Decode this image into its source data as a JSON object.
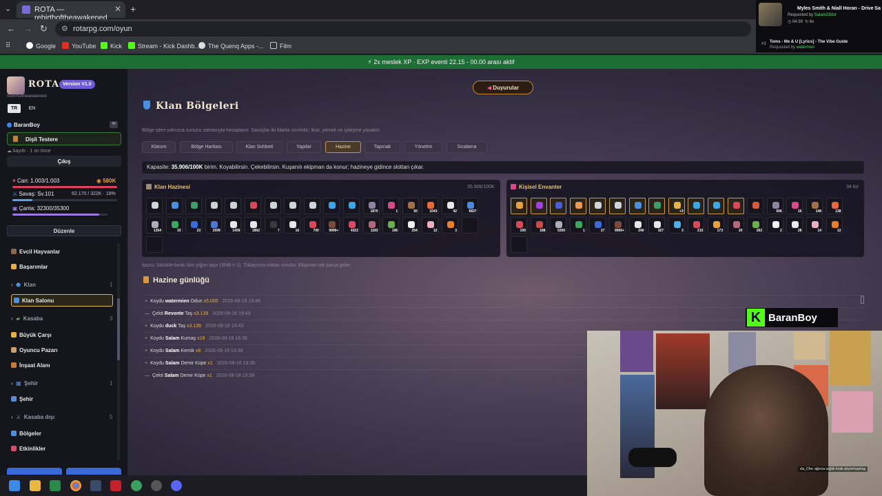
{
  "browser": {
    "tab_title": "ROTA — rebirthoftheawakened",
    "url": "rotarpg.com/oyun",
    "bookmarks": [
      "Google",
      "YouTube",
      "Kick",
      "Stream - Kick Dashb...",
      "The Quenq Apps -...",
      "Film"
    ]
  },
  "music": {
    "title": "Myles Smith & Niall Horan - Drive Sa",
    "requested_label": "Requested by",
    "requested_by": "Salam23dur",
    "time": "04:39",
    "plays": "6x",
    "queue_num": "#3",
    "next_title": "Toms - Me & U [Lyrics] - The Vibe Guide",
    "next_requested_by": "watermen"
  },
  "banner": "2x meslek XP · EXP eventi 22.15 - 00.00 arası aktif",
  "sidebar": {
    "brand": "ROTA",
    "version": "Version V1.0",
    "brand_sub": "rebirthoftheawakened",
    "lang_tr": "TR",
    "lang_en": "EN",
    "player": "BaranBoy",
    "job": "Dişli Testere",
    "last_seen": "kayıtlı · 1 sn önce",
    "logout": "Çıkış",
    "stats": {
      "hp_label": "Can: 1.003/1.003",
      "gold": "580K",
      "war_label": "Savaş: Sv.101",
      "war_value": "62.170 / 322K · 19%",
      "bag_label": "Çanta: 32300/35300",
      "hp_fill": 1.0,
      "war_fill": 0.19,
      "bag_fill": 0.915
    },
    "edit": "Düzenle",
    "nav": {
      "pets": "Evcil Hayvanlar",
      "achievements": "Başarımlar",
      "clan_header": "Klan",
      "clan_count": "1",
      "clan_hall": "Klan Salonu",
      "town_header": "Kasaba",
      "town_count": "3",
      "big_market": "Büyük Çarşı",
      "player_market": "Oyuncu Pazarı",
      "construction": "İnşaat Alanı",
      "city_header": "Şehir",
      "city_count": "1",
      "city": "Şehir",
      "outside_header": "Kasaba dışı",
      "outside_count": "5",
      "regions": "Bölgeler",
      "events": "Etkinlikler"
    }
  },
  "main": {
    "announce": "Duyurular",
    "title": "Klan Bölgeleri",
    "subtitle": "Bölge işleri yalnızca sunucu zamanıyla hesaplanır. Savaşlar iki klanla sınırlıdır; iksir, yemek ve iyileşme yasaktır.",
    "tabs": [
      "Klanım",
      "Bölge Haritası",
      "Klan Sohbeti",
      "Yapılar",
      "Hazine",
      "Tapınak",
      "Yönetim",
      "Sıralama"
    ],
    "capacity_prefix": "Kapasite:",
    "capacity_value": "35.906/100K",
    "capacity_suffix": "birim. Koyabilirsin. Çekebilirsin. Kuşanılı ekipman da konur; hazineye gidince slottan çıkar.",
    "clan_treasury_title": "Klan Hazinesi",
    "clan_treasury_meta": "35.906/100K",
    "inventory_title": "Kişisel Envanter",
    "inventory_meta": "34 tür",
    "treasury_slots": [
      {
        "icon": "chain",
        "color": "#cfd3da",
        "count": ""
      },
      {
        "icon": "shield",
        "color": "#4b8fe0",
        "count": ""
      },
      {
        "icon": "helm",
        "color": "#3e9e6a",
        "count": ""
      },
      {
        "icon": "swords",
        "color": "#cfcfd6",
        "count": ""
      },
      {
        "icon": "swords",
        "color": "#cfcfd6",
        "count": ""
      },
      {
        "icon": "armor",
        "color": "#d8485a",
        "count": ""
      },
      {
        "icon": "chain",
        "color": "#cfd3da",
        "count": ""
      },
      {
        "icon": "chain",
        "color": "#cfd3da",
        "count": ""
      },
      {
        "icon": "chain",
        "color": "#cfd3da",
        "count": ""
      },
      {
        "icon": "gem",
        "color": "#3aa7e8",
        "count": ""
      },
      {
        "icon": "gem",
        "color": "#3aa7e8",
        "count": ""
      },
      {
        "icon": "medal",
        "color": "#8d84a0",
        "count": "1870"
      },
      {
        "icon": "hook",
        "color": "#d84a8a",
        "count": "1"
      },
      {
        "icon": "ore",
        "color": "#a0704a",
        "count": "50"
      },
      {
        "icon": "orb",
        "color": "#e86a3a",
        "count": "1043"
      },
      {
        "icon": "cloth",
        "color": "#e8e8ec",
        "count": "42"
      },
      {
        "icon": "fish",
        "color": "#4a8ad8",
        "count": "6837"
      },
      {
        "icon": "chain2",
        "color": "#aab0ba",
        "count": "1354"
      },
      {
        "icon": "herb",
        "color": "#3aa860",
        "count": "33"
      },
      {
        "icon": "bluecrys",
        "color": "#3a6ad8",
        "count": "23"
      },
      {
        "icon": "feather",
        "color": "#4a7ad8",
        "count": "2599"
      },
      {
        "icon": "pearl",
        "color": "#e6e6ea",
        "count": "1459"
      },
      {
        "icon": "bone",
        "color": "#e6e6ea",
        "count": "1892"
      },
      {
        "icon": "box",
        "color": "#3a3a3e",
        "count": "7"
      },
      {
        "icon": "paper",
        "color": "#e6e6ea",
        "count": "16"
      },
      {
        "icon": "scissors",
        "color": "#d84a5a",
        "count": "700"
      },
      {
        "icon": "bottle",
        "color": "#7a4a3a",
        "count": "9999+"
      },
      {
        "icon": "brick",
        "color": "#d84a6a",
        "count": "4322"
      },
      {
        "icon": "hog",
        "color": "#b06a7a",
        "count": "1183"
      },
      {
        "icon": "plant",
        "color": "#6ab04a",
        "count": "196"
      },
      {
        "icon": "square",
        "color": "#f0f0f2",
        "count": "254"
      },
      {
        "icon": "potion",
        "color": "#e8b0c0",
        "count": "12"
      },
      {
        "icon": "flame",
        "color": "#e8802a",
        "count": "3"
      },
      {
        "icon": "empty",
        "color": "",
        "count": ""
      },
      {
        "icon": "empty",
        "color": "",
        "count": ""
      }
    ],
    "inventory_slots": [
      {
        "icon": "boat",
        "color": "#e8a040",
        "count": "",
        "gold": true
      },
      {
        "icon": "purple",
        "color": "#a040e0",
        "count": "",
        "gold": true
      },
      {
        "icon": "staff",
        "color": "#4a5ad8",
        "count": "",
        "gold": true
      },
      {
        "icon": "tent",
        "color": "#e89a50",
        "count": "",
        "gold": true
      },
      {
        "icon": "chain",
        "color": "#cfd3da",
        "count": "",
        "gold": true
      },
      {
        "icon": "chain",
        "color": "#cfd3da",
        "count": "",
        "gold": true
      },
      {
        "icon": "shield",
        "color": "#4b8fe0",
        "count": "",
        "gold": true
      },
      {
        "icon": "helm",
        "color": "#3e9e6a",
        "count": "",
        "gold": true
      },
      {
        "icon": "sword",
        "color": "#e6b04a",
        "count": "+3",
        "gold": true
      },
      {
        "icon": "gem",
        "color": "#3aa7e8",
        "count": "",
        "gold": true
      },
      {
        "icon": "gem",
        "color": "#3aa7e8",
        "count": "",
        "gold": true
      },
      {
        "icon": "armor",
        "color": "#d8485a",
        "count": "",
        "gold": true
      },
      {
        "icon": "dagger",
        "color": "#d85a3a",
        "count": "",
        "gold": false
      },
      {
        "icon": "medal",
        "color": "#8d84a0",
        "count": "506",
        "gold": false
      },
      {
        "icon": "hook",
        "color": "#d84a8a",
        "count": "16",
        "gold": false
      },
      {
        "icon": "ore",
        "color": "#a0704a",
        "count": "148",
        "gold": false
      },
      {
        "icon": "orb",
        "color": "#e86a3a",
        "count": "138",
        "gold": false
      },
      {
        "icon": "redball",
        "color": "#d84a5a",
        "count": "199",
        "gold": false
      },
      {
        "icon": "meat",
        "color": "#c84a4a",
        "count": "188",
        "gold": false
      },
      {
        "icon": "chain2",
        "color": "#aab0ba",
        "count": "5350",
        "gold": false
      },
      {
        "icon": "herb",
        "color": "#3aa860",
        "count": "1",
        "gold": false
      },
      {
        "icon": "bluecrys",
        "color": "#3a6ad8",
        "count": "27",
        "gold": false
      },
      {
        "icon": "bottle",
        "color": "#7a4a3a",
        "count": "9999+",
        "gold": false
      },
      {
        "icon": "pearl",
        "color": "#e6e6ea",
        "count": "240",
        "gold": false
      },
      {
        "icon": "bone",
        "color": "#e6e6ea",
        "count": "327",
        "gold": false
      },
      {
        "icon": "diamond",
        "color": "#4ab0e8",
        "count": "3",
        "gold": false
      },
      {
        "icon": "feather",
        "color": "#d84a5a",
        "count": "215",
        "gold": false
      },
      {
        "icon": "bag",
        "color": "#e8a030",
        "count": "173",
        "gold": false
      },
      {
        "icon": "hog",
        "color": "#b06a7a",
        "count": "20",
        "gold": false
      },
      {
        "icon": "plant",
        "color": "#6ab04a",
        "count": "262",
        "gold": false
      },
      {
        "icon": "square",
        "color": "#f0f0f2",
        "count": "2",
        "gold": false
      },
      {
        "icon": "cloth",
        "color": "#e8e8ec",
        "count": "28",
        "gold": false
      },
      {
        "icon": "potion",
        "color": "#e8b0c0",
        "count": "14",
        "gold": false
      },
      {
        "icon": "flame",
        "color": "#e8802a",
        "count": "12",
        "gold": false
      },
      {
        "icon": "empty",
        "color": "",
        "count": "",
        "gold": false
      }
    ],
    "tip": "İpucu: Sürükle-bırak tüm yığını taşır (Shift = 1). Tıklayınca miktar sorulur. Ekipman tek parça gider.",
    "log_title": "Hazine günlüğü",
    "log": [
      {
        "sign": "+",
        "action": "Koydu",
        "user": "watermien",
        "item": "Odun",
        "qty": "x5.000",
        "date": "2026-08-16 19:49"
      },
      {
        "sign": "—",
        "action": "Çekti",
        "user": "Revonte",
        "item": "Taş",
        "qty": "x3.139",
        "date": "2026-08-16 19:43"
      },
      {
        "sign": "+",
        "action": "Koydu",
        "user": "duck",
        "item": "Taş",
        "qty": "x3.139",
        "date": "2026-08-16 19:43"
      },
      {
        "sign": "+",
        "action": "Koydu",
        "user": "Salam",
        "item": "Kumaş",
        "qty": "x16",
        "date": "2026-08-16 19:38"
      },
      {
        "sign": "+",
        "action": "Koydu",
        "user": "Salam",
        "item": "Kemik",
        "qty": "x8",
        "date": "2026-08-16 19:38"
      },
      {
        "sign": "+",
        "action": "Koydu",
        "user": "Salam",
        "item": "Demir Küpe",
        "qty": "x1",
        "date": "2026-08-16 19:38"
      },
      {
        "sign": "—",
        "action": "Çekti",
        "user": "Salam",
        "item": "Demir Küpe",
        "qty": "x1",
        "date": "2026-08-16 19:38"
      }
    ]
  },
  "overlay": {
    "kick_name": "BaranBoy",
    "kick_letter": "K",
    "cam_chat": "slu_Che: ağzına sağlık knak alıyormuşmuş"
  },
  "colors": {
    "accent_gold": "#e2b94a",
    "banner_green": "#1d6e35",
    "version_purple": "#6f5bd4",
    "kick_green": "#53fc18"
  }
}
